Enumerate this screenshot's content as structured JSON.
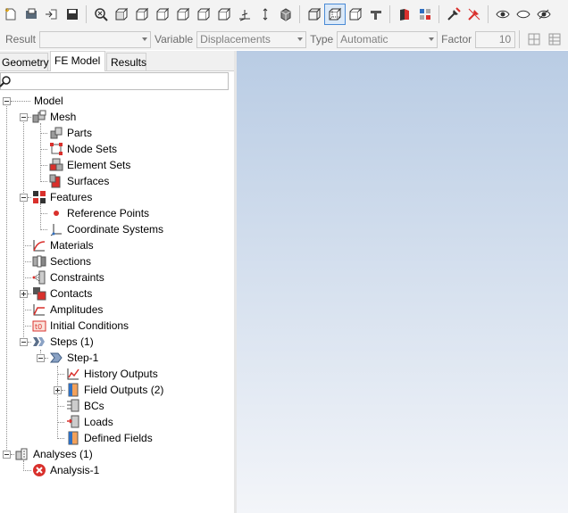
{
  "toolbar": {
    "icons": [
      "new-part-icon",
      "open-icon",
      "import-icon",
      "save-icon",
      "zoom-fit-icon",
      "view-iso-icon",
      "view-front-icon",
      "view-back-icon",
      "view-left-icon",
      "view-right-icon",
      "view-top-icon",
      "view-bottom-icon",
      "view-axis-icon",
      "perspective-icon",
      "wireframe-icon",
      "shaded-edges-icon",
      "hidden-lines-icon",
      "surface-icon",
      "color-part-icon",
      "mesh-display-icon",
      "pick-icon",
      "unpick-icon",
      "show-icon",
      "hide-icon",
      "hide-others-icon"
    ]
  },
  "result_bar": {
    "result_label": "Result",
    "result_value": "",
    "variable_label": "Variable",
    "variable_value": "Displacements",
    "type_label": "Type",
    "type_value": "Automatic",
    "factor_label": "Factor",
    "factor_value": "10"
  },
  "tabs": [
    "Geometry",
    "FE Model",
    "Results"
  ],
  "tree": {
    "model": "Model",
    "mesh": "Mesh",
    "parts": "Parts",
    "node_sets": "Node Sets",
    "element_sets": "Element Sets",
    "surfaces": "Surfaces",
    "features": "Features",
    "reference_points": "Reference Points",
    "coordinate_systems": "Coordinate Systems",
    "materials": "Materials",
    "sections": "Sections",
    "constraints": "Constraints",
    "contacts": "Contacts",
    "amplitudes": "Amplitudes",
    "initial_conditions": "Initial Conditions",
    "steps": "Steps (1)",
    "step1": "Step-1",
    "history_outputs": "History Outputs",
    "field_outputs": "Field Outputs (2)",
    "bcs": "BCs",
    "loads": "Loads",
    "defined_fields": "Defined Fields",
    "analyses": "Analyses (1)",
    "analysis1": "Analysis-1"
  },
  "colors": {
    "accent": "#2f6fc1",
    "error": "#d9302c",
    "viewport_top": "#b9cce4",
    "viewport_bottom": "#f3f5f9"
  }
}
